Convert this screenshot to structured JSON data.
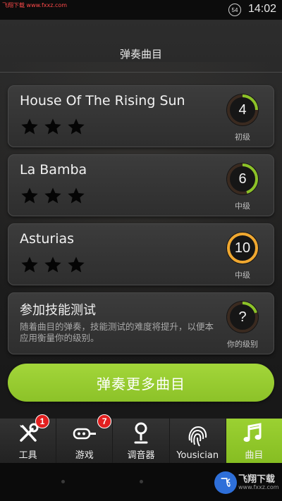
{
  "status_bar": {
    "watermark_text": "飞翔下载 www.fxxz.com",
    "battery": "54",
    "time": "14:02"
  },
  "page": {
    "title": "弹奏曲目"
  },
  "songs": [
    {
      "title": "House Of The Rising Sun",
      "level": "4",
      "level_label": "初级",
      "level_progress": 0.25,
      "ring_color": "#8cc228"
    },
    {
      "title": "La Bamba",
      "level": "6",
      "level_label": "中级",
      "level_progress": 0.45,
      "ring_color": "#8cc228"
    },
    {
      "title": "Asturias",
      "level": "10",
      "level_label": "中级",
      "level_progress": 1.0,
      "ring_color": "#f0a830"
    }
  ],
  "skill_test": {
    "title": "参加技能测试",
    "description": "随着曲目的弹奏，技能测试的难度将提升，以便本应用衡量你的级别。",
    "level": "?",
    "level_label": "你的级别",
    "level_progress": 0.2,
    "ring_color": "#8cc228"
  },
  "more_button": {
    "label": "弹奏更多曲目"
  },
  "nav": {
    "items": [
      {
        "label": "工具",
        "icon": "tools-icon",
        "badge": "1"
      },
      {
        "label": "游戏",
        "icon": "game-guitar-icon",
        "badge": "7"
      },
      {
        "label": "调音器",
        "icon": "tuner-icon"
      },
      {
        "label": "Yousician",
        "icon": "fingerprint-icon"
      },
      {
        "label": "曲目",
        "icon": "music-notes-icon",
        "active": true
      }
    ]
  },
  "watermark": {
    "logo_text": "飞翔下载",
    "logo_char": "飞",
    "url": "www.fxxz.com"
  },
  "colors": {
    "accent_green": "#8cc228",
    "badge_red": "#e21f1f",
    "ring_orange": "#f0a830"
  }
}
